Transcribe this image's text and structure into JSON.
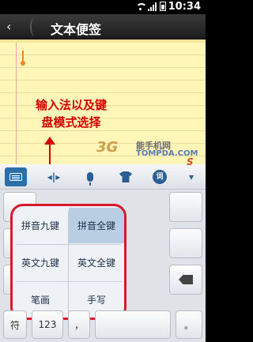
{
  "status_bar": {
    "time": "10:34"
  },
  "title_bar": {
    "back_label": "‹",
    "title": "文本便签"
  },
  "annotation": {
    "line1": "输入法以及键",
    "line2": "盘模式选择"
  },
  "keyboard_toolbar": {
    "logo": "S",
    "items": [
      "keyboard-icon",
      "cursor-move-icon",
      "mic-icon",
      "skin-icon",
      "dict-icon",
      "chevron-down-icon"
    ]
  },
  "keyboard": {
    "left_keys": [
      "",
      "",
      ""
    ],
    "right_keys": {
      "backspace": "backspace-icon",
      "enter": "↵"
    },
    "popup": {
      "options": [
        {
          "label": "拼音九键",
          "selected": false
        },
        {
          "label": "拼音全键",
          "selected": true
        },
        {
          "label": "英文九键",
          "selected": false
        },
        {
          "label": "英文全键",
          "selected": false
        },
        {
          "label": "笔画",
          "selected": false
        },
        {
          "label": "手写",
          "selected": false
        }
      ]
    },
    "bottom_row": {
      "symbol": "符",
      "numbers": "123",
      "comma": "，",
      "period": "。"
    }
  },
  "watermark": {
    "logo": "3G",
    "brand": "能手机网",
    "url": "TOMPDA.COM"
  }
}
